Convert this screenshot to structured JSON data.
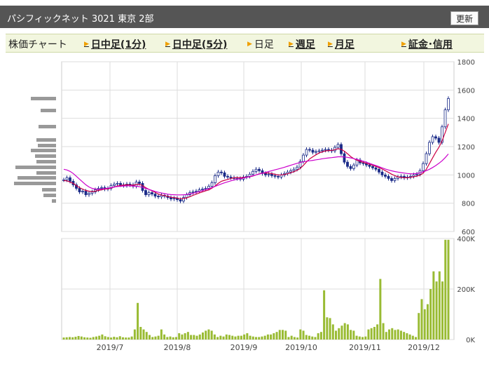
{
  "header": {
    "title": "パシフィックネット  3021  東京 2部",
    "refresh_label": "更新"
  },
  "nav": {
    "items": [
      {
        "label": "株価チャート",
        "link": false,
        "arrow": false
      },
      {
        "label": "日中足(1分)",
        "link": true,
        "arrow": true
      },
      {
        "label": "日中足(5分)",
        "link": true,
        "arrow": true
      },
      {
        "label": "日足",
        "link": false,
        "arrow": true
      },
      {
        "label": "週足",
        "link": true,
        "arrow": true
      },
      {
        "label": "月足",
        "link": true,
        "arrow": true
      },
      {
        "label": "証金･信用",
        "link": true,
        "arrow": true
      }
    ]
  },
  "colors": {
    "header_bg": "#555555",
    "nav_bg": "#f2f6df",
    "candle": "#1a2a88",
    "ma_short": "#cc0044",
    "ma_long": "#cc00cc",
    "volume": "#99bb33"
  },
  "chart_data": [
    {
      "type": "candlestick",
      "y_ticks": [
        "1800",
        "1600",
        "1400",
        "1200",
        "1000",
        "800",
        "600"
      ],
      "ylim": [
        600,
        1800
      ],
      "x_labels": [
        "2019/7",
        "2019/8",
        "2019/9",
        "2019/10",
        "2019/11",
        "2019/12"
      ],
      "series": [
        {
          "role": "close",
          "values": [
            965,
            980,
            955,
            930,
            905,
            880,
            885,
            860,
            870,
            880,
            895,
            905,
            910,
            900,
            905,
            925,
            935,
            940,
            930,
            925,
            935,
            930,
            920,
            950,
            940,
            890,
            860,
            875,
            865,
            850,
            845,
            855,
            850,
            840,
            830,
            835,
            825,
            815,
            840,
            860,
            875,
            880,
            885,
            895,
            900,
            905,
            920,
            945,
            995,
            1020,
            1015,
            990,
            985,
            980,
            975,
            975,
            970,
            985,
            990,
            1005,
            1025,
            1040,
            1030,
            1010,
            1000,
            1005,
            995,
            990,
            985,
            1000,
            1010,
            1020,
            1030,
            1040,
            1055,
            1095,
            1140,
            1180,
            1175,
            1160,
            1165,
            1170,
            1175,
            1180,
            1175,
            1170,
            1195,
            1215,
            1150,
            1090,
            1060,
            1045,
            1070,
            1105,
            1085,
            1080,
            1070,
            1060,
            1050,
            1040,
            1020,
            1000,
            990,
            975,
            960,
            975,
            985,
            990,
            980,
            985,
            990,
            1000,
            1005,
            1030,
            1080,
            1150,
            1230,
            1270,
            1260,
            1230,
            1340,
            1460,
            1540
          ]
        },
        {
          "role": "ma_short",
          "values": [
            960,
            958,
            950,
            940,
            925,
            910,
            900,
            890,
            885,
            882,
            885,
            890,
            895,
            900,
            902,
            907,
            915,
            922,
            926,
            928,
            930,
            929,
            928,
            932,
            934,
            925,
            910,
            898,
            887,
            877,
            865,
            858,
            854,
            848,
            842,
            840,
            836,
            832,
            833,
            838,
            846,
            856,
            864,
            872,
            880,
            887,
            894,
            906,
            922,
            940,
            955,
            962,
            968,
            975,
            980,
            982,
            980,
            982,
            984,
            987,
            992,
            1000,
            1008,
            1013,
            1014,
            1013,
            1009,
            1004,
            1000,
            1000,
            1003,
            1008,
            1015,
            1023,
            1032,
            1046,
            1067,
            1092,
            1113,
            1128,
            1142,
            1155,
            1163,
            1170,
            1172,
            1173,
            1178,
            1185,
            1181,
            1168,
            1150,
            1130,
            1115,
            1104,
            1096,
            1089,
            1082,
            1075,
            1068,
            1060,
            1052,
            1042,
            1030,
            1018,
            1005,
            995,
            987,
            982,
            980,
            980,
            983,
            987,
            991,
            998,
            1012,
            1040,
            1080,
            1120,
            1160,
            1195,
            1240,
            1300,
            1360
          ]
        },
        {
          "role": "ma_long",
          "values": [
            1040,
            1035,
            1025,
            1010,
            990,
            970,
            950,
            930,
            915,
            905,
            900,
            898,
            900,
            903,
            906,
            910,
            915,
            918,
            920,
            922,
            923,
            923,
            922,
            920,
            917,
            912,
            905,
            898,
            890,
            883,
            877,
            872,
            868,
            864,
            861,
            860,
            859,
            859,
            860,
            862,
            866,
            870,
            876,
            882,
            889,
            896,
            902,
            910,
            919,
            928,
            936,
            944,
            951,
            958,
            964,
            969,
            974,
            978,
            983,
            988,
            994,
            1000,
            1006,
            1012,
            1018,
            1024,
            1030,
            1036,
            1042,
            1048,
            1054,
            1061,
            1068,
            1075,
            1082,
            1088,
            1093,
            1097,
            1100,
            1103,
            1107,
            1110,
            1114,
            1117,
            1120,
            1122,
            1125,
            1128,
            1128,
            1127,
            1124,
            1120,
            1115,
            1110,
            1104,
            1097,
            1090,
            1082,
            1074,
            1066,
            1058,
            1050,
            1042,
            1035,
            1029,
            1024,
            1020,
            1016,
            1013,
            1010,
            1008,
            1008,
            1010,
            1015,
            1022,
            1030,
            1040,
            1052,
            1066,
            1082,
            1100,
            1122,
            1148
          ]
        }
      ]
    },
    {
      "type": "bar",
      "y_ticks": [
        "400K",
        "200K",
        "0K"
      ],
      "ylim": [
        0,
        400000
      ],
      "values": [
        8000,
        9000,
        10000,
        9000,
        11000,
        14000,
        12000,
        9000,
        8000,
        7000,
        10000,
        12000,
        15000,
        20000,
        13000,
        10000,
        8000,
        11000,
        9000,
        13000,
        9000,
        8000,
        8000,
        12000,
        40000,
        145000,
        50000,
        40000,
        30000,
        18000,
        10000,
        12000,
        15000,
        40000,
        20000,
        10000,
        12000,
        9000,
        10000,
        25000,
        20000,
        25000,
        30000,
        18000,
        18000,
        15000,
        20000,
        28000,
        35000,
        40000,
        35000,
        20000,
        10000,
        15000,
        12000,
        20000,
        18000,
        15000,
        12000,
        15000,
        15000,
        20000,
        25000,
        15000,
        12000,
        10000,
        10000,
        12000,
        15000,
        20000,
        20000,
        25000,
        30000,
        38000,
        38000,
        35000,
        10000,
        15000,
        10000,
        8000,
        40000,
        35000,
        18000,
        15000,
        12000,
        10000,
        25000,
        30000,
        195000,
        88000,
        85000,
        60000,
        35000,
        45000,
        55000,
        65000,
        60000,
        38000,
        35000,
        15000,
        12000,
        10000,
        12000,
        40000,
        45000,
        50000,
        60000,
        240000,
        65000,
        30000,
        40000,
        45000,
        38000,
        40000,
        35000,
        30000,
        25000,
        20000,
        15000,
        10000,
        105000,
        160000,
        120000,
        140000,
        200000,
        270000,
        230000,
        270000,
        230000,
        395000,
        395000
      ]
    }
  ]
}
